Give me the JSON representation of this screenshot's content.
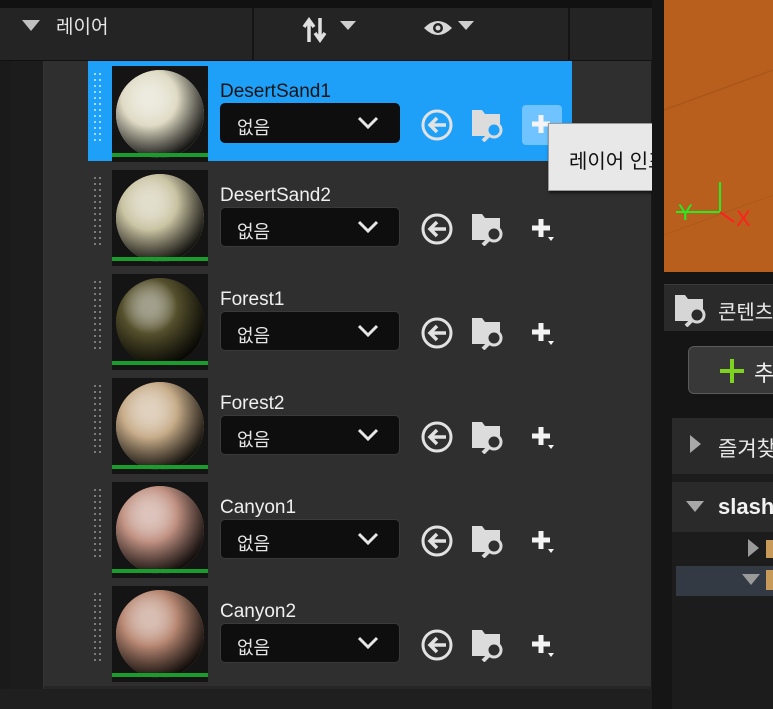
{
  "colors": {
    "accent_selected": "#1ea0f8",
    "layer_usage_bar": "#1a9d2c",
    "add_icon_green": "#7ed321",
    "gizmo_x": "#ff2020",
    "gizmo_y": "#22ee22"
  },
  "header": {
    "title": "레이어",
    "sort_icon": "sort-arrows-icon",
    "visibility_icon": "eye-icon"
  },
  "layers": [
    {
      "name": "DesertSand1",
      "info": "없음",
      "selected": true,
      "sphere_color": "#dedac4"
    },
    {
      "name": "DesertSand2",
      "info": "없음",
      "selected": false,
      "sphere_color": "#c9c3a2"
    },
    {
      "name": "Forest1",
      "info": "없음",
      "selected": false,
      "sphere_color": "#55502c"
    },
    {
      "name": "Forest2",
      "info": "없음",
      "selected": false,
      "sphere_color": "#c6ab88"
    },
    {
      "name": "Canyon1",
      "info": "없음",
      "selected": false,
      "sphere_color": "#c09182"
    },
    {
      "name": "Canyon2",
      "info": "없음",
      "selected": false,
      "sphere_color": "#b88873"
    }
  ],
  "tooltip": {
    "text": "레이어 인포 생성"
  },
  "right_panel": {
    "viewport_gizmo": {
      "x_label": "X",
      "y_label": "Y"
    },
    "content_tab": {
      "label": "콘텐츠"
    },
    "add_button": {
      "label": "추가"
    },
    "tree": {
      "favorites_label": "즐겨찾기",
      "project_label": "slash"
    }
  }
}
